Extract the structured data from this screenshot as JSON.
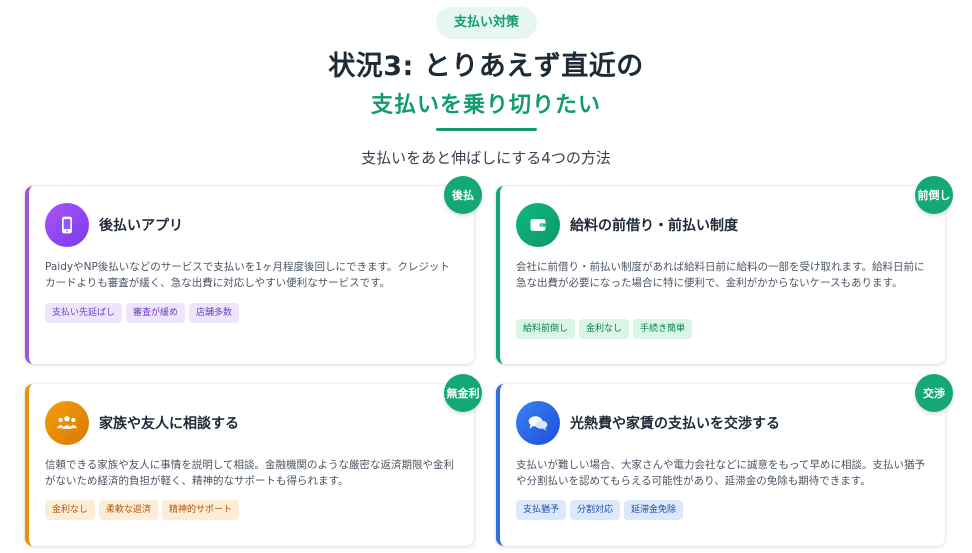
{
  "header": {
    "badge": "支払い対策",
    "title_line1": "状況3: とりあえず直近の",
    "title_line2": "支払いを乗り切りたい",
    "subtitle": "支払いをあと伸ばしにする4つの方法"
  },
  "cards": [
    {
      "corner": "後払",
      "title": "後払いアプリ",
      "icon": "smartphone-icon",
      "desc": "PaidyやNP後払いなどのサービスで支払いを1ヶ月程度後回しにできます。クレジットカードよりも審査が緩く、急な出費に対応しやすい便利なサービスです。",
      "tags": [
        "支払い先延ばし",
        "審査が緩め",
        "店舗多数"
      ]
    },
    {
      "corner": "前倒し",
      "title": "給料の前借り・前払い制度",
      "icon": "wallet-icon",
      "desc": "会社に前借り・前払い制度があれば給料日前に給料の一部を受け取れます。給料日前に急な出費が必要になった場合に特に便利で、金利がかからないケースもあります。",
      "tags": [
        "給料前倒し",
        "金利なし",
        "手続き簡単"
      ]
    },
    {
      "corner": "無金利",
      "title": "家族や友人に相談する",
      "icon": "people-icon",
      "desc": "信頼できる家族や友人に事情を説明して相談。金融機関のような厳密な返済期限や金利がないため経済的負担が軽く、精神的なサポートも得られます。",
      "tags": [
        "金利なし",
        "柔軟な返済",
        "精神的サポート"
      ]
    },
    {
      "corner": "交渉",
      "title": "光熱費や家賃の支払いを交渉する",
      "icon": "chat-icon",
      "desc": "支払いが難しい場合、大家さんや電力会社などに誠意をもって早めに相談。支払い猶予や分割払いを認めてもらえる可能性があり、延滞金の免除も期待できます。",
      "tags": [
        "支払猶予",
        "分割対応",
        "延滞金免除"
      ]
    }
  ]
}
